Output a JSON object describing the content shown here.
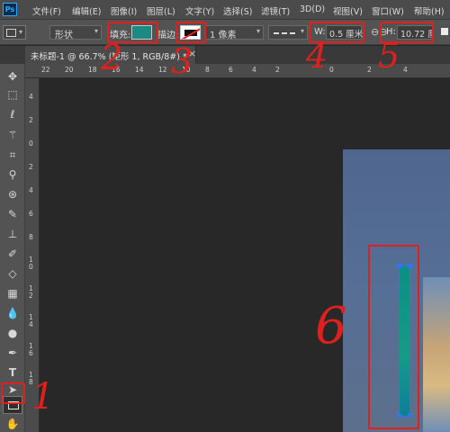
{
  "app": {
    "logo": "Ps"
  },
  "menu": [
    "文件(F)",
    "编辑(E)",
    "图像(I)",
    "图层(L)",
    "文字(Y)",
    "选择(S)",
    "滤镜(T)",
    "3D(D)",
    "视图(V)",
    "窗口(W)",
    "帮助(H)"
  ],
  "options": {
    "mode": "形状",
    "fill_label": "填充:",
    "stroke_label": "描边:",
    "stroke_width": "1 像素",
    "w_label": "W:",
    "w_value": "0.5 厘米",
    "link_icon": "link-icon",
    "h_label": "H:",
    "h_value": "10.72 厘"
  },
  "colors": {
    "fill": "#1a8a82",
    "annotation": "#e0201c",
    "selection": "#2f73ff"
  },
  "document_tab": {
    "title": "未标题-1 @ 66.7% (矩形 1, RGB/8#) *",
    "close": "×"
  },
  "rulers": {
    "top": [
      "22",
      "20",
      "18",
      "16",
      "14",
      "12",
      "10",
      "8",
      "6",
      "4",
      "2",
      "0",
      "2",
      "4"
    ],
    "left": [
      "4",
      "2",
      "0",
      "2",
      "4",
      "6",
      "8",
      "1\n0",
      "1\n2",
      "1\n4",
      "1\n6",
      "1\n8"
    ]
  },
  "tools": [
    "move-icon",
    "marquee-icon",
    "lasso-icon",
    "magic-wand-icon",
    "crop-icon",
    "eyedropper-icon",
    "healing-icon",
    "brush-icon",
    "stamp-icon",
    "history-brush-icon",
    "eraser-icon",
    "gradient-icon",
    "blur-icon",
    "dodge-icon",
    "pen-icon",
    "type-icon",
    "path-select-icon",
    "rectangle-tool-icon",
    "hand-icon"
  ],
  "annotations": [
    "1",
    "2",
    "3",
    "4",
    "5",
    "6"
  ]
}
